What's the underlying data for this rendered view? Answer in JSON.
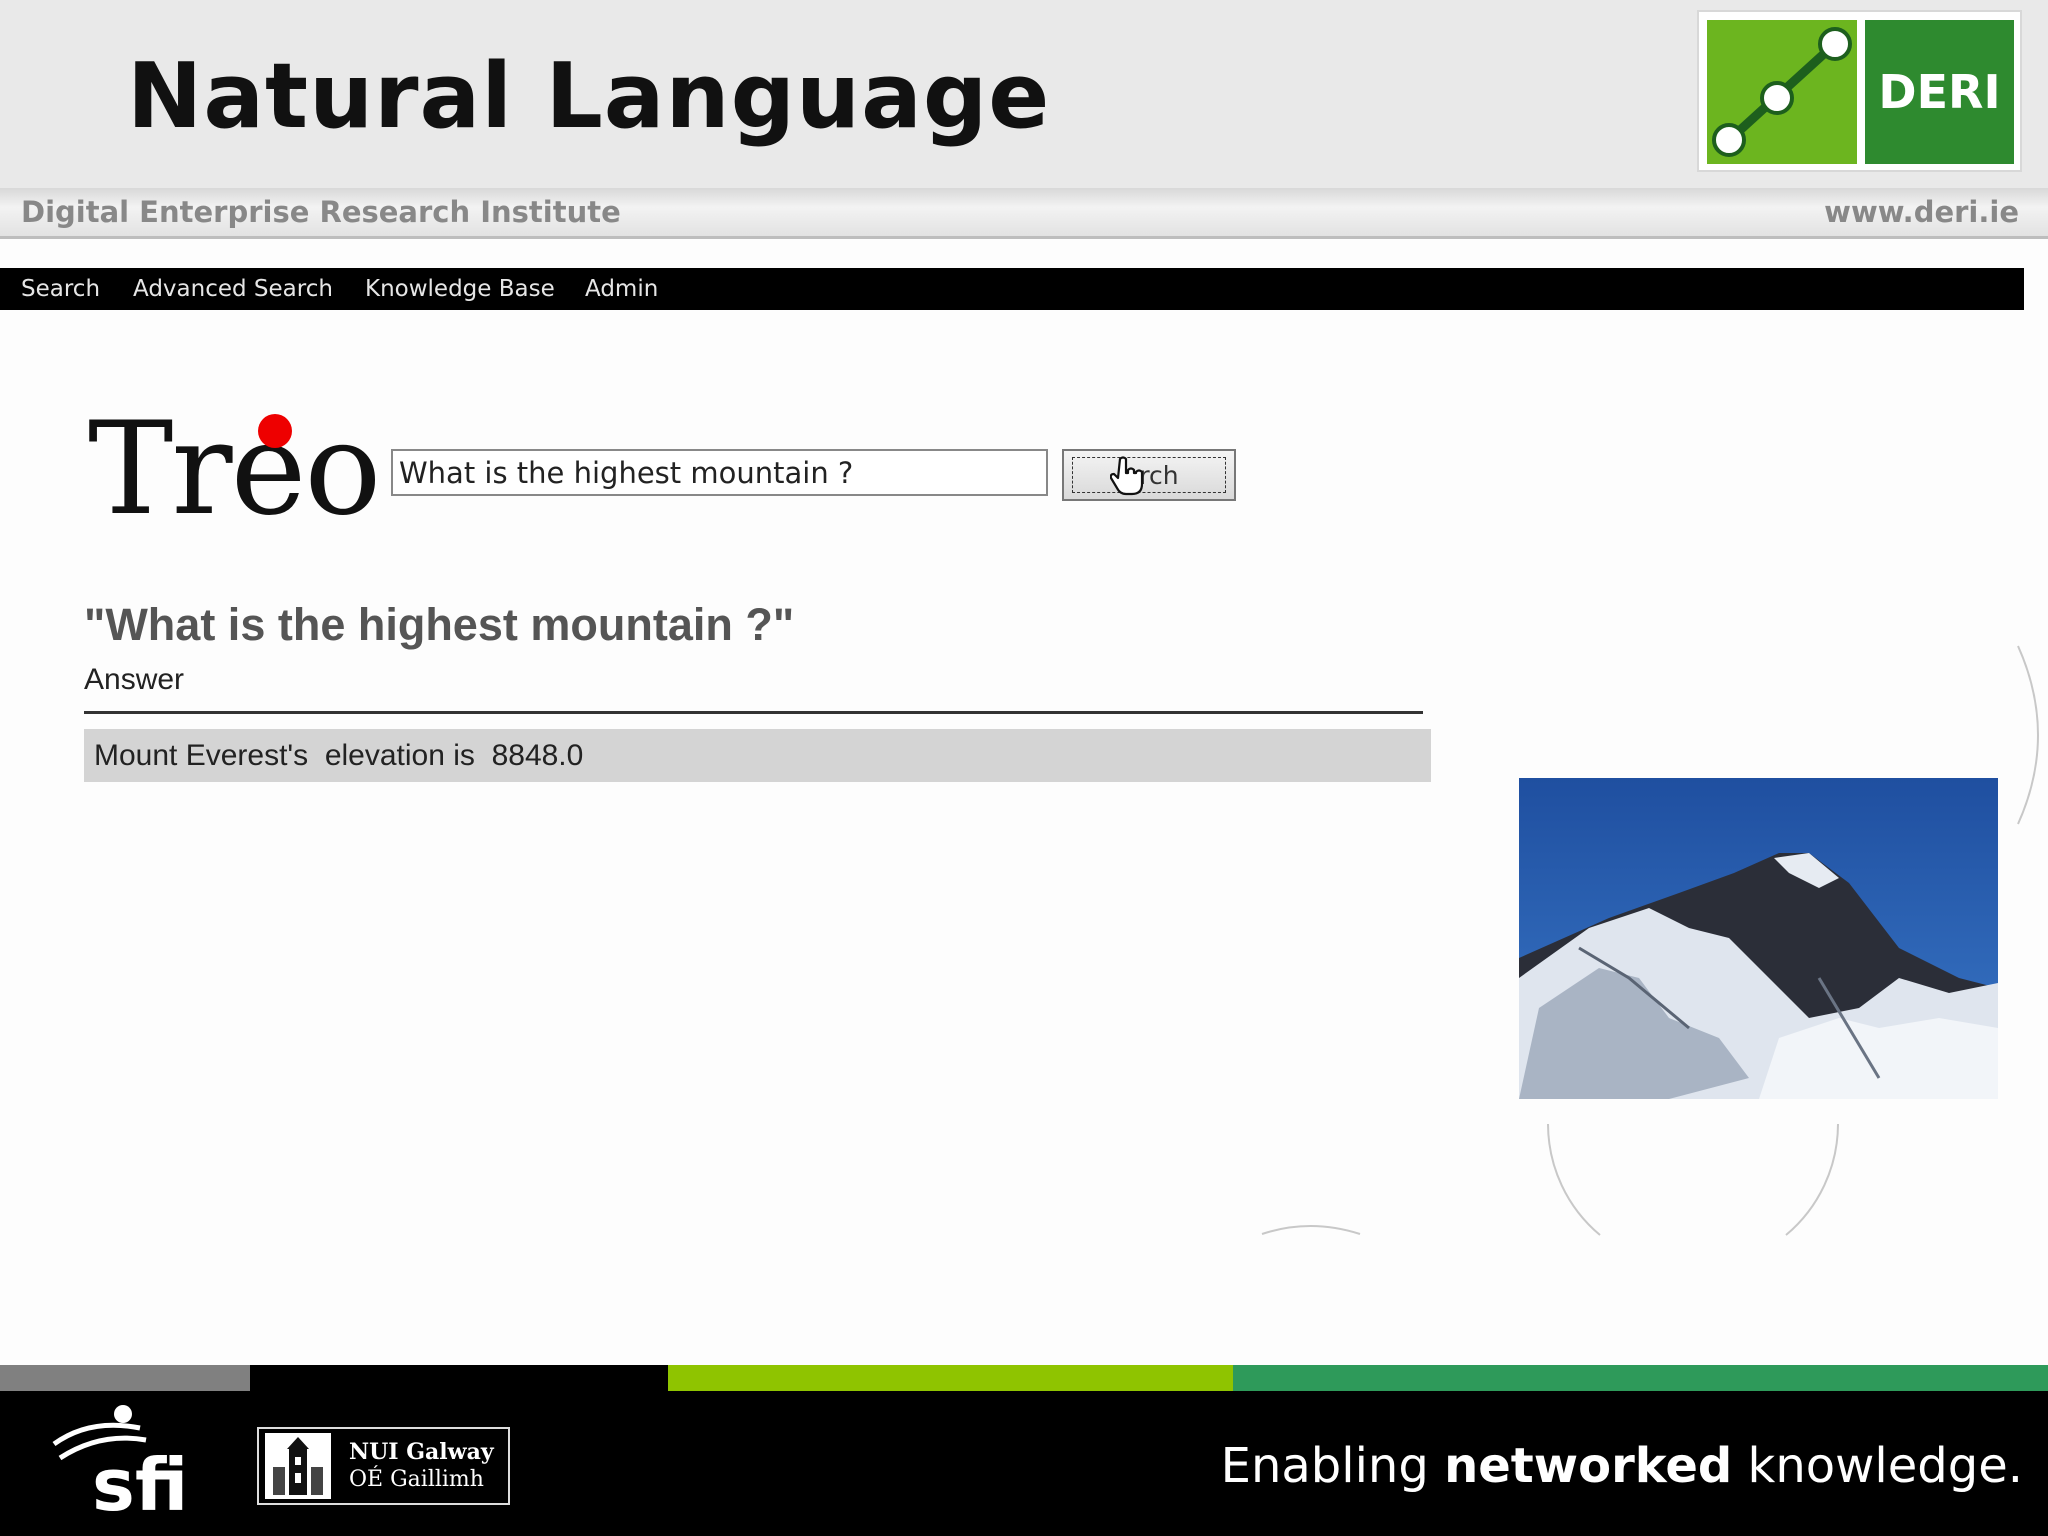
{
  "slide": {
    "title": "Natural Language",
    "institute": "Digital Enterprise Research Institute",
    "url": "www.deri.ie",
    "logo_text": "DERI"
  },
  "app_nav": {
    "items": [
      {
        "label": "Search"
      },
      {
        "label": "Advanced Search"
      },
      {
        "label": "Knowledge Base"
      },
      {
        "label": "Admin"
      }
    ]
  },
  "treo": {
    "logo_text": "Treo",
    "search_value": "What is the highest mountain ?",
    "search_button_label": "rch"
  },
  "result": {
    "query_title": "\"What is the highest mountain ?\"",
    "answer_label": "Answer",
    "answer_text": "Mount Everest's  elevation is  8848.0"
  },
  "footer": {
    "nui_line1": "NUI Galway",
    "nui_line2": "OÉ Gaillimh",
    "tagline_pre": "Enabling ",
    "tagline_bold": "networked",
    "tagline_post": " knowledge."
  },
  "colors": {
    "deri_light_green": "#6cb51f",
    "deri_dark_green": "#2e8a2f",
    "band_gray": "#808080",
    "band_black": "#000000",
    "band_lime": "#8fc400",
    "band_green": "#2e9a5a",
    "treo_dot": "#e00000"
  }
}
